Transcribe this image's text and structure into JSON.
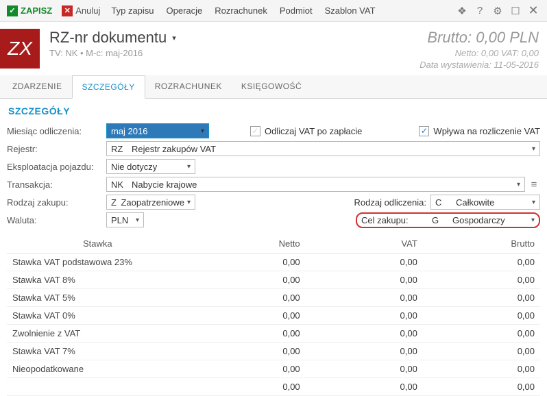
{
  "toolbar": {
    "save": "ZAPISZ",
    "cancel": "Anuluj",
    "menu": [
      "Typ zapisu",
      "Operacje",
      "Rozrachunek",
      "Podmiot",
      "Szablon VAT"
    ]
  },
  "header": {
    "logo": "ZX",
    "title": "RZ-nr dokumentu",
    "subtitle": "TV: NK  •  M-c: maj-2016",
    "brutto": "Brutto: 0,00 PLN",
    "netto_vat": "Netto: 0,00 VAT: 0,00",
    "date": "Data wystawienia: 11-05-2016"
  },
  "tabs": [
    "ZDARZENIE",
    "SZCZEGÓŁY",
    "ROZRACHUNEK",
    "KSIĘGOWOŚĆ"
  ],
  "active_tab": 1,
  "section_title": "SZCZEGÓŁY",
  "form": {
    "miesiac_label": "Miesiąc odliczenia:",
    "miesiac_value": "maj 2016",
    "odliczaj_label": "Odliczaj VAT po zapłacie",
    "wplywa_label": "Wpływa na rozliczenie VAT",
    "rejestr_label": "Rejestr:",
    "rejestr_code": "RZ",
    "rejestr_name": "Rejestr zakupów VAT",
    "eksploatacja_label": "Eksploatacja pojazdu:",
    "eksploatacja_value": "Nie dotyczy",
    "transakcja_label": "Transakcja:",
    "transakcja_code": "NK",
    "transakcja_name": "Nabycie krajowe",
    "rodzaj_zakupu_label": "Rodzaj zakupu:",
    "rodzaj_zakupu_code": "Z",
    "rodzaj_zakupu_name": "Zaopatrzeniowe",
    "rodzaj_odliczenia_label": "Rodzaj odliczenia:",
    "rodzaj_odliczenia_code": "C",
    "rodzaj_odliczenia_name": "Całkowite",
    "waluta_label": "Waluta:",
    "waluta_value": "PLN",
    "cel_zakupu_label": "Cel zakupu:",
    "cel_zakupu_code": "G",
    "cel_zakupu_name": "Gospodarczy"
  },
  "table": {
    "headers": [
      "Stawka",
      "Netto",
      "VAT",
      "Brutto"
    ],
    "rows": [
      {
        "label": "Stawka VAT podstawowa 23%",
        "netto": "0,00",
        "vat": "0,00",
        "brutto": "0,00"
      },
      {
        "label": "Stawka VAT 8%",
        "netto": "0,00",
        "vat": "0,00",
        "brutto": "0,00"
      },
      {
        "label": "Stawka VAT 5%",
        "netto": "0,00",
        "vat": "0,00",
        "brutto": "0,00"
      },
      {
        "label": "Stawka VAT 0%",
        "netto": "0,00",
        "vat": "0,00",
        "brutto": "0,00"
      },
      {
        "label": "Zwolnienie z VAT",
        "netto": "0,00",
        "vat": "0,00",
        "brutto": "0,00"
      },
      {
        "label": "Stawka VAT 7%",
        "netto": "0,00",
        "vat": "0,00",
        "brutto": "0,00"
      },
      {
        "label": "Nieopodatkowane",
        "netto": "0,00",
        "vat": "0,00",
        "brutto": "0,00"
      }
    ],
    "total": {
      "netto": "0,00",
      "vat": "0,00",
      "brutto": "0,00"
    }
  }
}
